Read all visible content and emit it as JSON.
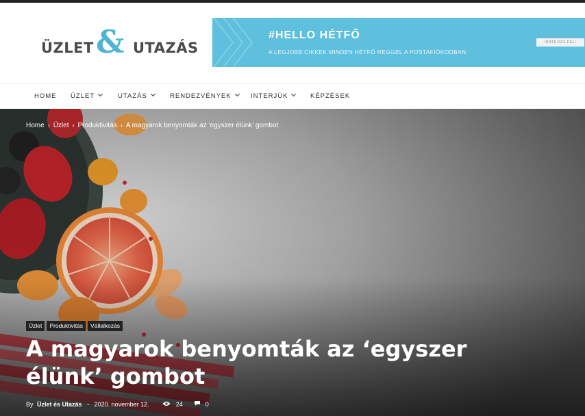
{
  "logo": {
    "word_left": "ÜZLET",
    "ampersand": "&",
    "word_right": "UTAZÁS"
  },
  "banner": {
    "title": "#HELLO HÉTFŐ",
    "subtitle": "A LEGJOBB CIKKEK MINDEN HÉTFŐ REGGEL A POSTAFIÓKODBAN",
    "button": "IRATKOZZ FEL!",
    "color": "#5ec0dc"
  },
  "nav": {
    "items": [
      {
        "label": "HOME",
        "dropdown": false
      },
      {
        "label": "ÜZLET",
        "dropdown": true
      },
      {
        "label": "UTAZÁS",
        "dropdown": true
      },
      {
        "label": "RENDEZVÉNYEK",
        "dropdown": true
      },
      {
        "label": "INTERJÚK",
        "dropdown": true
      },
      {
        "label": "KÉPZÉSEK",
        "dropdown": false
      }
    ]
  },
  "breadcrumb": {
    "items": [
      "Home",
      "Üzlet",
      "Produktivitás",
      "A magyarok benyomták az ‘egyszer élünk’ gombot"
    ],
    "separator": "›"
  },
  "article": {
    "tags": [
      "Üzlet",
      "Produktivitás",
      "Vállalkozás"
    ],
    "title": "A magyarok benyomták az ‘egyszer élünk’ gombot",
    "by": "By",
    "author": "Üzlet és Utazás",
    "date_separator": "-",
    "date": "2020. november 12.",
    "views": "24",
    "comments": "0",
    "view_icon": "eye-icon",
    "comment_icon": "comment-bubble-icon"
  }
}
